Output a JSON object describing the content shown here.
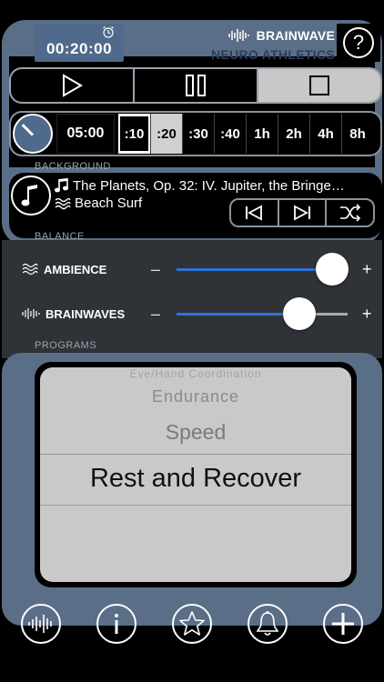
{
  "header": {
    "timer": "00:20:00",
    "brand_name": "BRAINWAVE",
    "brand_sub": "NEURO ATHLETICS",
    "help_label": "?"
  },
  "duration": {
    "custom": "05:00",
    "options": [
      ":10",
      ":20",
      ":30",
      ":40",
      "1h",
      "2h",
      "4h",
      "8h"
    ]
  },
  "sections": {
    "background": "BACKGROUND",
    "balance": "BALANCE",
    "programs": "PROGRAMS"
  },
  "background": {
    "music_track": "The Planets, Op. 32: IV. Jupiter, the Bringe…",
    "ambience_track": "Beach Surf"
  },
  "balance": {
    "ambience_label": "AMBIENCE",
    "brainwaves_label": "BRAINWAVES",
    "minus": "–",
    "plus": "+",
    "ambience_level": 0.91,
    "brainwaves_level": 0.72
  },
  "programs": {
    "items": [
      "Eye/Hand Coordination",
      "Endurance",
      "Speed",
      "Rest and Recover"
    ],
    "selected": "Rest and Recover"
  },
  "colors": {
    "panel": "#5a6e87",
    "accent_blue": "#2f73d6",
    "timer_bg": "#4f6a8a"
  }
}
